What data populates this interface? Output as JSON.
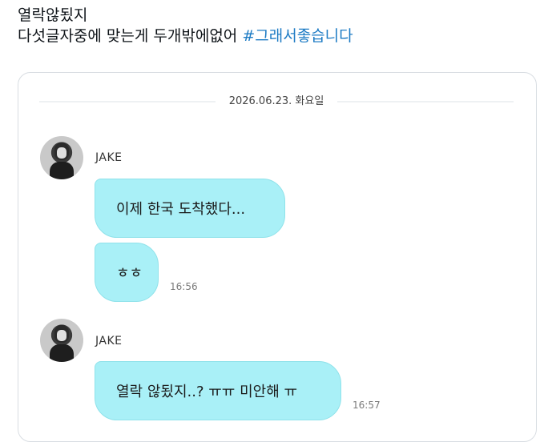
{
  "tweet": {
    "line1": "열락않됬지",
    "line2_prefix": "다섯글자중에 맞는게 두개밖에없어 ",
    "hashtag": "#그래서좋습니다"
  },
  "chat": {
    "date": "2026.06.23. 화요일",
    "groups": [
      {
        "sender": "JAKE",
        "messages": [
          {
            "text": "이제 한국 도착했다..."
          },
          {
            "text": "ㅎㅎ",
            "time": "16:56"
          }
        ]
      },
      {
        "sender": "JAKE",
        "messages": [
          {
            "text": "열락 않됬지..? ㅠㅠ 미안해 ㅠ",
            "time": "16:57"
          }
        ]
      }
    ]
  },
  "colors": {
    "bubble": "#a9f0f7",
    "hashtag": "#1d7bc4"
  }
}
